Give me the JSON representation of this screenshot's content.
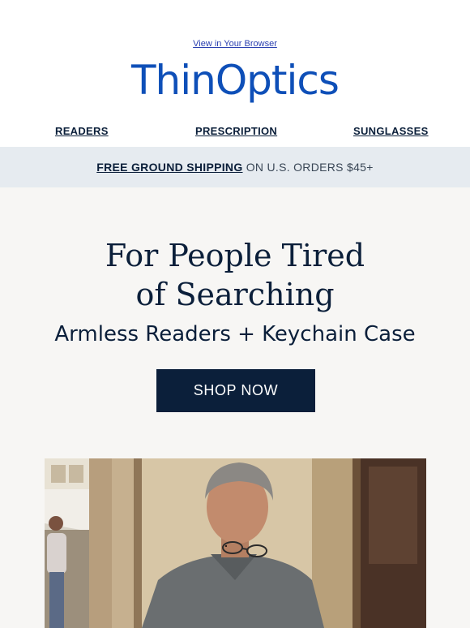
{
  "header": {
    "browser_link": "View in Your Browser",
    "logo_text": "ThinOptics"
  },
  "nav": {
    "items": [
      "READERS",
      "PRESCRIPTION",
      "SUNGLASSES"
    ]
  },
  "shipping_banner": {
    "highlight": "FREE GROUND SHIPPING",
    "rest": " ON U.S. ORDERS $45+"
  },
  "hero": {
    "headline_line1": "For People Tired",
    "headline_line2": "of Searching",
    "subheadline": "Armless Readers + Keychain Case",
    "cta_label": "SHOP NOW"
  },
  "colors": {
    "brand_blue": "#0e4fb8",
    "navy": "#0b1f3a",
    "banner_bg": "#e6ebf0",
    "hero_bg": "#f7f6f4"
  },
  "image": {
    "subject": "man-wearing-armless-reading-glasses"
  }
}
